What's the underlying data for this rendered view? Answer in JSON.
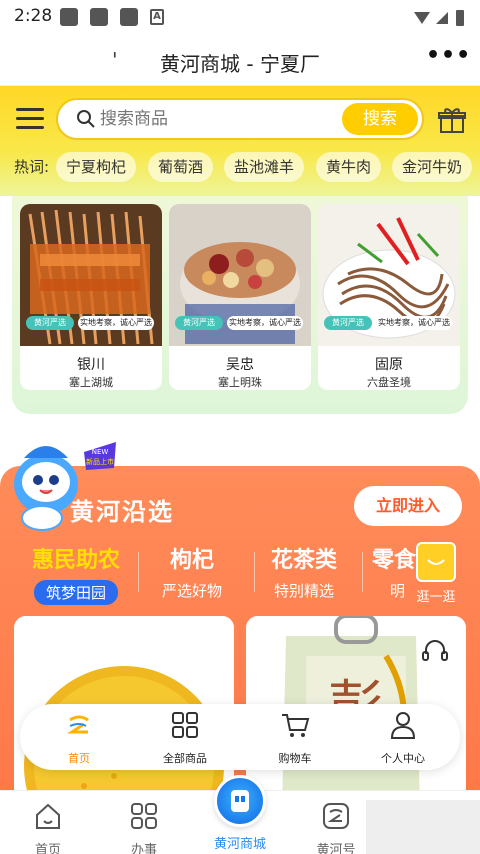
{
  "status": {
    "time": "2:28"
  },
  "titlebar": {
    "title": "黄河商城 - 宁夏厂",
    "left_fragment": "'",
    "more": "•••"
  },
  "header": {
    "search_placeholder": "搜索商品",
    "search_button": "搜索",
    "hot_label": "热词:",
    "hot_tags": [
      "宁夏枸杞",
      "葡萄酒",
      "盐池滩羊",
      "黄牛肉",
      "金河牛奶"
    ]
  },
  "regions": [
    {
      "name": "银川",
      "sub": "塞上湖城",
      "badge_a": "黄河严选",
      "badge_b": "实地考察，诚心严选"
    },
    {
      "name": "吴忠",
      "sub": "塞上明珠",
      "badge_a": "黄河严选",
      "badge_b": "实地考察，诚心严选"
    },
    {
      "name": "固原",
      "sub": "六盘圣境",
      "badge_a": "黄河严选",
      "badge_b": "实地考察，诚心严选"
    }
  ],
  "mascot": {
    "badge_new": "NEW",
    "badge_text": "新品上市"
  },
  "section": {
    "title": "黄河沿选",
    "enter_button": "立即进入",
    "categories": [
      {
        "title": "惠民助农",
        "sub": "筑梦田园"
      },
      {
        "title": "枸杞",
        "sub": "严选好物"
      },
      {
        "title": "花茶类",
        "sub": "特别精选"
      },
      {
        "title": "零食",
        "sub": "明"
      }
    ],
    "stroll_label": "逛一逛"
  },
  "mini_nav": [
    {
      "label": "首页"
    },
    {
      "label": "全部商品"
    },
    {
      "label": "购物车"
    },
    {
      "label": "个人中心"
    }
  ],
  "tabbar": [
    {
      "label": "首页"
    },
    {
      "label": "办事"
    },
    {
      "label": "黄河商城"
    },
    {
      "label": "黄河号"
    }
  ],
  "colors": {
    "accent_yellow": "#ffd726",
    "orange": "#ff7a4a",
    "blue": "#2a8cf0"
  }
}
